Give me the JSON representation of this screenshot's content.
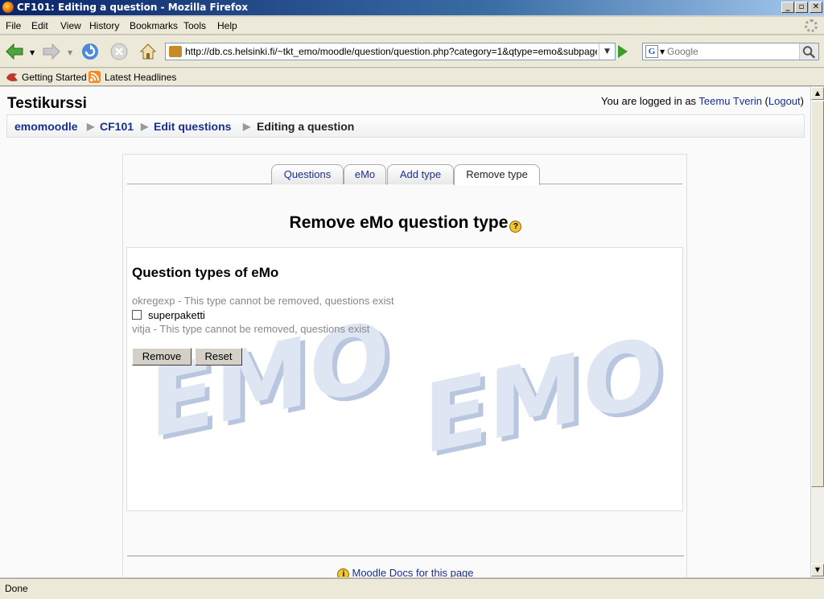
{
  "window": {
    "title": "CF101: Editing a question - Mozilla Firefox",
    "controls": [
      "_",
      "▫",
      "✕"
    ]
  },
  "menu": [
    "File",
    "Edit",
    "View",
    "History",
    "Bookmarks",
    "Tools",
    "Help"
  ],
  "nav": {
    "url": "http://db.cs.helsinki.fi/~tkt_emo/moodle/question/question.php?category=1&qtype=emo&subpage=emo",
    "search_placeholder": "Google"
  },
  "bookmarks": [
    "Getting Started",
    "Latest Headlines"
  ],
  "page": {
    "course_title": "Testikurssi",
    "login": {
      "prefix": "You are logged in as ",
      "user": "Teemu Tverin",
      "logout": "Logout"
    },
    "breadcrumb": [
      "emomoodle",
      "CF101",
      "Edit questions",
      "Editing a question"
    ],
    "breadcrumb_sep": "▶",
    "tabs": [
      {
        "label": "Questions"
      },
      {
        "label": "eMo"
      },
      {
        "label": "Add type"
      },
      {
        "label": "Remove type",
        "active": true
      }
    ],
    "heading": "Remove eMo question type",
    "section_title": "Question types of eMo",
    "types": [
      {
        "text": "okregexp - This type cannot be removed, questions exist"
      },
      {
        "text": "superpaketti"
      },
      {
        "text": "vitja - This type cannot be removed, questions exist"
      }
    ],
    "buttons": {
      "remove": "Remove",
      "reset": "Reset"
    },
    "watermark": "EMO",
    "docs_link": "Moodle Docs for this page"
  },
  "status": "Done",
  "colors": {
    "link": "#1a2f8a",
    "watermark": "#c9d4e8"
  }
}
